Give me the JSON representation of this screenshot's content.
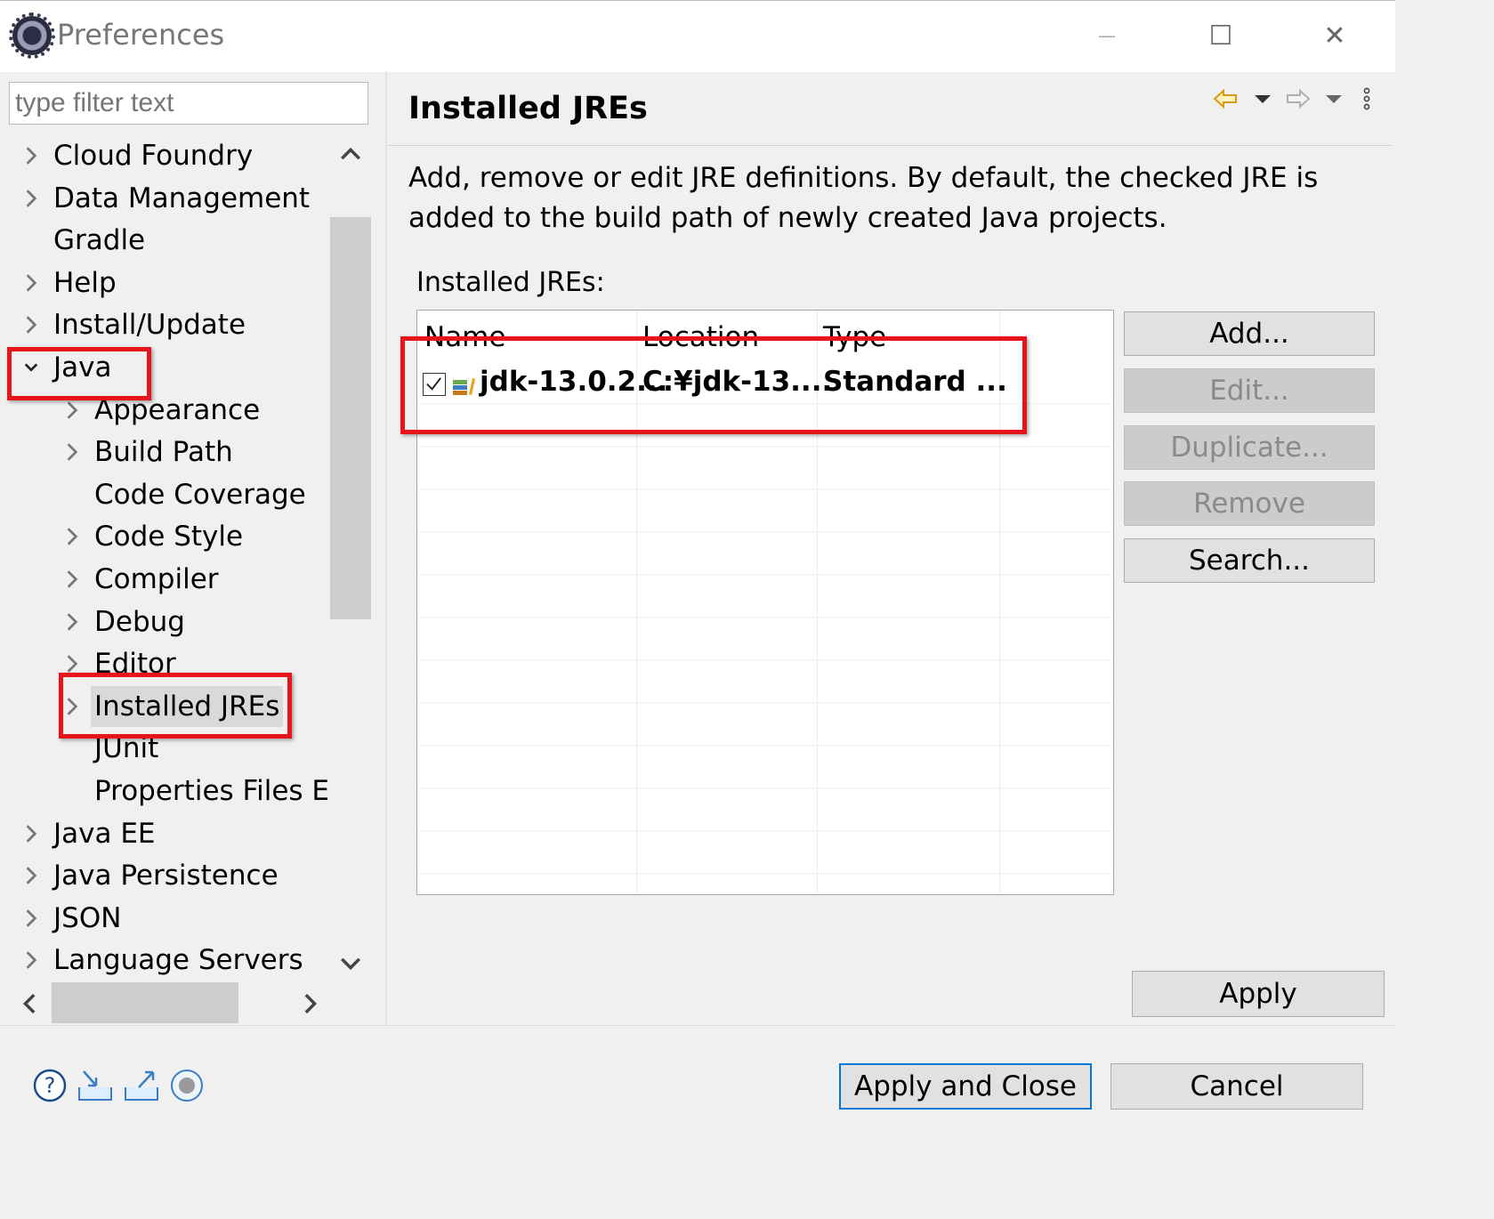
{
  "window": {
    "title": "Preferences",
    "minimize": "—",
    "maximize": "☐",
    "close": "✕"
  },
  "sidebar": {
    "filter_placeholder": "type filter text",
    "items": [
      {
        "label": "Cloud Foundry",
        "expander": "collapsed",
        "level": 0
      },
      {
        "label": "Data Management",
        "expander": "collapsed",
        "level": 0
      },
      {
        "label": "Gradle",
        "expander": "none",
        "level": 0
      },
      {
        "label": "Help",
        "expander": "collapsed",
        "level": 0
      },
      {
        "label": "Install/Update",
        "expander": "collapsed",
        "level": 0
      },
      {
        "label": "Java",
        "expander": "expanded",
        "level": 0
      },
      {
        "label": "Appearance",
        "expander": "collapsed",
        "level": 1
      },
      {
        "label": "Build Path",
        "expander": "collapsed",
        "level": 1
      },
      {
        "label": "Code Coverage",
        "expander": "none",
        "level": 1
      },
      {
        "label": "Code Style",
        "expander": "collapsed",
        "level": 1
      },
      {
        "label": "Compiler",
        "expander": "collapsed",
        "level": 1
      },
      {
        "label": "Debug",
        "expander": "collapsed",
        "level": 1
      },
      {
        "label": "Editor",
        "expander": "collapsed",
        "level": 1
      },
      {
        "label": "Installed JREs",
        "expander": "collapsed",
        "level": 1,
        "selected": true
      },
      {
        "label": "JUnit",
        "expander": "none",
        "level": 1
      },
      {
        "label": "Properties Files Ec",
        "expander": "none",
        "level": 1
      },
      {
        "label": "Java EE",
        "expander": "collapsed",
        "level": 0
      },
      {
        "label": "Java Persistence",
        "expander": "collapsed",
        "level": 0
      },
      {
        "label": "JSON",
        "expander": "collapsed",
        "level": 0
      },
      {
        "label": "Language Servers",
        "expander": "collapsed",
        "level": 0
      }
    ]
  },
  "page": {
    "title": "Installed JREs",
    "description": "Add, remove or edit JRE definitions. By default, the checked JRE is added to the build path of newly created Java projects.",
    "table_label": "Installed JREs:",
    "columns": [
      "Name",
      "Location",
      "Type"
    ],
    "rows": [
      {
        "checked": true,
        "name": "jdk-13.0.2...",
        "location": "C:¥jdk-13....",
        "type": "Standard ..."
      }
    ],
    "buttons": {
      "add": "Add...",
      "edit": "Edit...",
      "duplicate": "Duplicate...",
      "remove": "Remove",
      "search": "Search..."
    },
    "apply": "Apply"
  },
  "footer": {
    "apply_and_close": "Apply and Close",
    "cancel": "Cancel"
  },
  "colors": {
    "highlight_box": "#e8141c",
    "default_button_border": "#0078d7",
    "nav_back_arrow": "#e8a317"
  },
  "icons": [
    "help-icon",
    "import-icon",
    "export-icon",
    "record-icon",
    "back-arrow-icon",
    "forward-arrow-icon",
    "view-menu-icon"
  ]
}
